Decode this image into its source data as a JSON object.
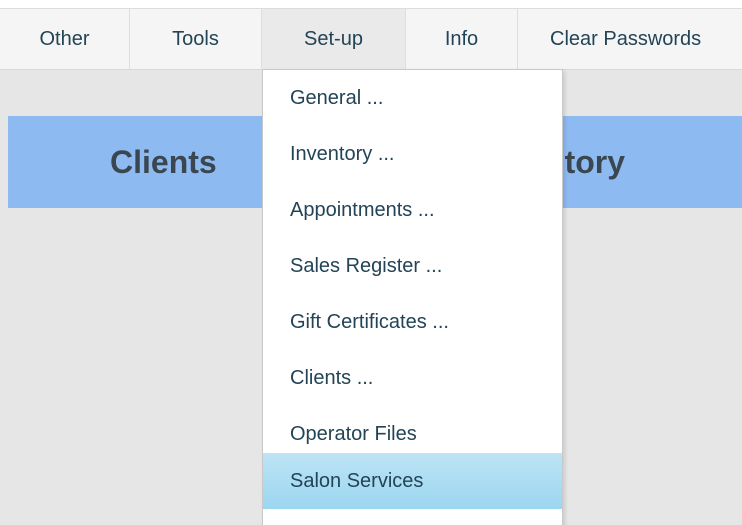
{
  "menubar": {
    "tabs": [
      {
        "label": "Other"
      },
      {
        "label": "Tools"
      },
      {
        "label": "Set-up"
      },
      {
        "label": "Info"
      },
      {
        "label": "Clear Passwords"
      }
    ],
    "active_tab": "Set-up"
  },
  "modules": {
    "clients_label": "Clients",
    "inventory_label": "Inventory"
  },
  "setup_menu": {
    "items": [
      {
        "label": "General ..."
      },
      {
        "label": "Inventory ..."
      },
      {
        "label": "Appointments ..."
      },
      {
        "label": "Sales Register ..."
      },
      {
        "label": "Gift Certificates ..."
      },
      {
        "label": "Clients ..."
      },
      {
        "label": "Operator Files"
      },
      {
        "label": "Salon Services"
      }
    ],
    "highlighted_item": "Salon Services"
  },
  "colors": {
    "module_bar": "#8ebaf2",
    "highlight": "#9bd6f0",
    "text": "#234456"
  }
}
